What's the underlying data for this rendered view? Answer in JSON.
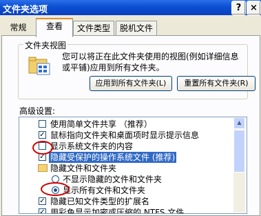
{
  "window": {
    "title": "文件夹选项",
    "help_glyph": "?",
    "close_glyph": "×"
  },
  "tabs": [
    {
      "label": "常规"
    },
    {
      "label": "查看",
      "selected": true
    },
    {
      "label": "文件类型"
    },
    {
      "label": "脱机文件"
    }
  ],
  "folder_views": {
    "legend": "文件夹视图",
    "description": "您可以将正在此文件夹使用的视图(例如详细信息或平铺)应用到所有文件夹。",
    "apply_button": "应用到所有文件夹(L)",
    "reset_button": "重置所有文件夹(R)"
  },
  "advanced": {
    "label": "高级设置:",
    "items": [
      {
        "type": "checkbox",
        "checked": false,
        "indent": 0,
        "label": "使用简单文件共享 （推荐）"
      },
      {
        "type": "checkbox",
        "checked": true,
        "indent": 0,
        "label": "鼠标指向文件夹和桌面项时显示提示信息"
      },
      {
        "type": "checkbox",
        "checked": false,
        "indent": 0,
        "label": "显示系统文件夹的内容",
        "highlighted": false
      },
      {
        "type": "checkbox",
        "checked": true,
        "indent": 0,
        "label": "隐藏受保护的操作系统文件 (推荐)",
        "highlighted": true
      },
      {
        "type": "folder",
        "indent": 0,
        "label": "隐藏文件和文件夹"
      },
      {
        "type": "radio",
        "checked": false,
        "indent": 1,
        "label": "不显示隐藏的文件和文件夹"
      },
      {
        "type": "radio",
        "checked": true,
        "indent": 1,
        "label": "显示所有文件和文件夹"
      },
      {
        "type": "checkbox",
        "checked": true,
        "indent": 0,
        "label": "隐藏已知文件类型的扩展名"
      },
      {
        "type": "checkbox",
        "checked": true,
        "indent": 0,
        "label": "用彩色显示加密或压缩的 NTFS 文件"
      }
    ]
  },
  "colors": {
    "titlebar": "#0a4fd2",
    "selection": "#316ac5",
    "annotation": "#d00000"
  },
  "icons": {
    "scroll_up": "▲",
    "check": "✓"
  }
}
